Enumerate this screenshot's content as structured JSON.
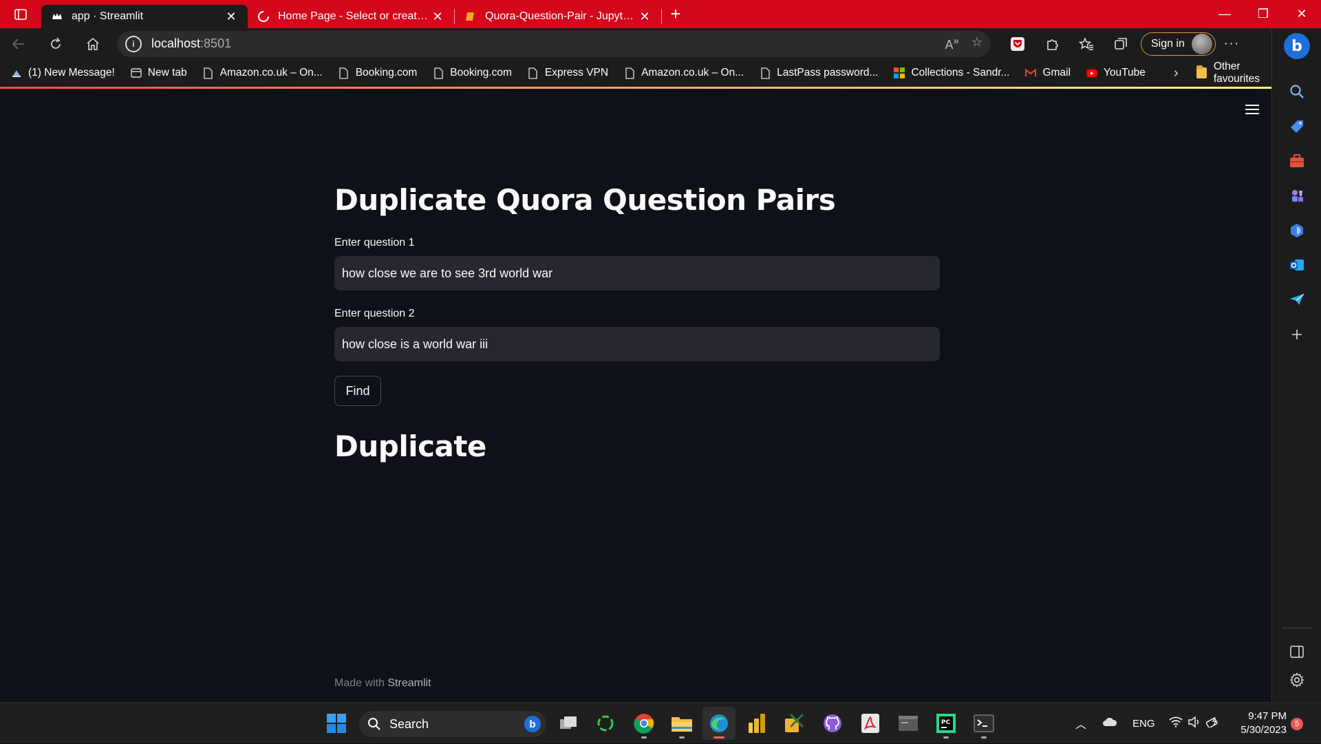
{
  "browser": {
    "tabs": [
      {
        "label": "app · Streamlit",
        "active": true
      },
      {
        "label": "Home Page - Select or create a n",
        "active": false
      },
      {
        "label": "Quora-Question-Pair - Jupyter N",
        "active": false
      }
    ],
    "address": {
      "host": "localhost",
      "port": ":8501"
    },
    "signin_label": "Sign in",
    "bookmarks": [
      {
        "label": "(1) New Message!",
        "icon": "message-icon"
      },
      {
        "label": "New tab",
        "icon": "newtab-icon"
      },
      {
        "label": "Amazon.co.uk – On...",
        "icon": "page-icon"
      },
      {
        "label": "Booking.com",
        "icon": "page-icon"
      },
      {
        "label": "Booking.com",
        "icon": "page-icon"
      },
      {
        "label": "Express VPN",
        "icon": "page-icon"
      },
      {
        "label": "Amazon.co.uk – On...",
        "icon": "page-icon"
      },
      {
        "label": "LastPass password...",
        "icon": "page-icon"
      },
      {
        "label": "Collections - Sandr...",
        "icon": "microsoft-icon"
      },
      {
        "label": "Gmail",
        "icon": "gmail-icon"
      },
      {
        "label": "YouTube",
        "icon": "youtube-icon"
      }
    ],
    "other_favourites": "Other favourites",
    "colors": {
      "titlebar": "#d3081b",
      "chrome": "#1c1c1c"
    }
  },
  "app": {
    "title": "Duplicate Quora Question Pairs",
    "q1_label": "Enter question 1",
    "q1_value": "how close we are to see 3rd world war",
    "q2_label": "Enter question 2",
    "q2_value": "how close is a world war iii",
    "find_label": "Find",
    "result": "Duplicate",
    "footer_prefix": "Made with ",
    "footer_brand": "Streamlit",
    "colors": {
      "background": "#0e1117",
      "input": "#262730",
      "text": "#fafafa"
    }
  },
  "taskbar": {
    "search_label": "Search",
    "language": "ENG",
    "time": "9:47 PM",
    "date": "5/30/2023",
    "notifications": "5"
  }
}
